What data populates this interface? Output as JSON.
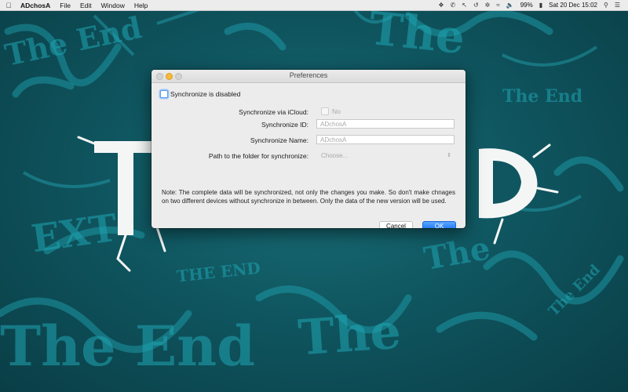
{
  "menubar": {
    "app_name": "ADchosA",
    "menus": [
      "File",
      "Edit",
      "Window",
      "Help"
    ],
    "battery": "99%",
    "clock": "Sat 20 Dec  15:02"
  },
  "window": {
    "title": "Preferences",
    "sync_toggle_label": "Synchronize is disabled",
    "icloud_label": "Synchronize via iCloud:",
    "icloud_value": "No",
    "sync_id_label": "Synchronize ID:",
    "sync_id_value": "ADchosA",
    "sync_name_label": "Synchronize Name:",
    "sync_name_value": "ADchosA",
    "path_label": "Path to the folder for synchronize:",
    "path_placeholder": "Choose...",
    "note": "Note: The complete data will be synchronized, not only the changes you make. So don't make chnages on two different devices without synchronize in between. Only the data of the new version will be used.",
    "cancel_label": "Cancel",
    "ok_label": "OK"
  },
  "colors": {
    "accent": "#1d74f5",
    "wallpaper_teal": "#1fa6b3"
  }
}
